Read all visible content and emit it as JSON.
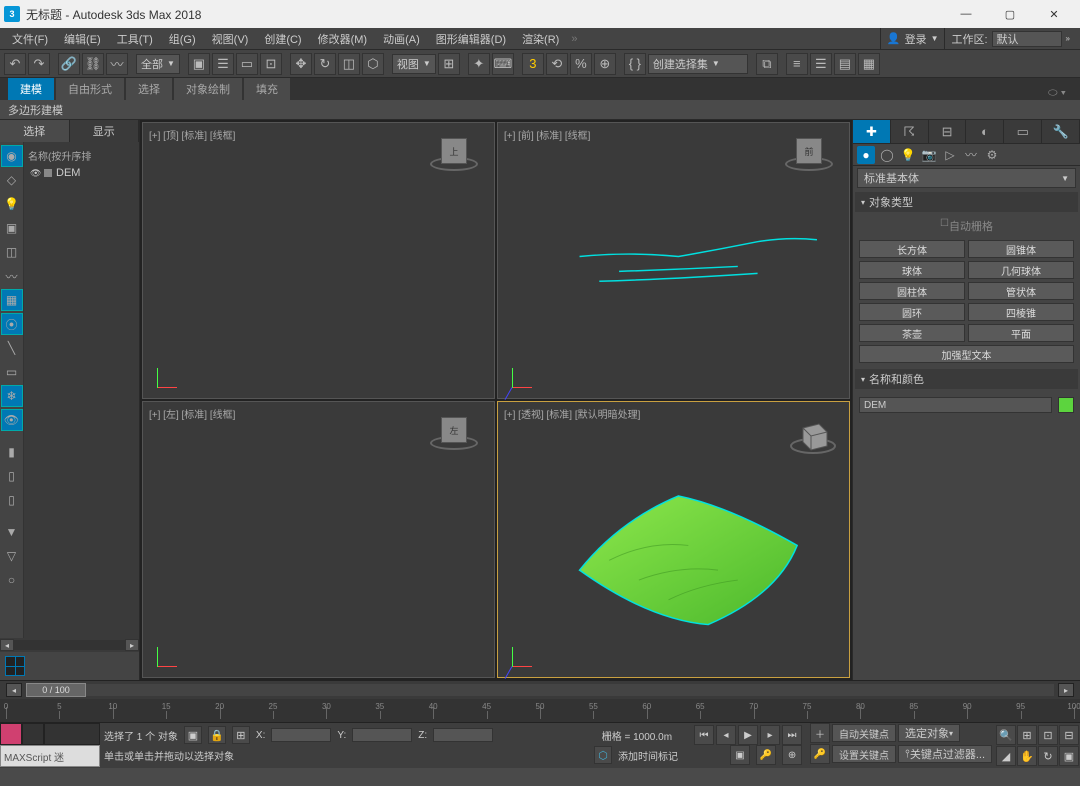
{
  "title": "无标题 - Autodesk 3ds Max 2018",
  "menu": {
    "items": [
      "文件(F)",
      "编辑(E)",
      "工具(T)",
      "组(G)",
      "视图(V)",
      "创建(C)",
      "修改器(M)",
      "动画(A)",
      "图形编辑器(D)",
      "渲染(R)"
    ],
    "login_label": "登录",
    "workarea_label": "工作区:",
    "workarea_value": "默认"
  },
  "toolbar": {
    "all_filter": "全部",
    "view_drop": "视图",
    "sel_set": "创建选择集"
  },
  "ribbon": {
    "tabs": [
      "建模",
      "自由形式",
      "选择",
      "对象绘制",
      "填充"
    ],
    "subtab": "多边形建模"
  },
  "left": {
    "tabs": [
      "选择",
      "显示"
    ],
    "tree_header": "名称(按升序排",
    "item_name": "DEM"
  },
  "viewports": {
    "tl": "[+] [顶] [标准] [线框]",
    "tr": "[+] [前] [标准] [线框]",
    "bl": "[+] [左] [标准] [线框]",
    "br": "[+] [透视] [标准] [默认明暗处理]",
    "cube_tl": "上",
    "cube_tr": "前",
    "cube_bl": "左"
  },
  "cmd": {
    "category": "标准基本体",
    "rollout1": "对象类型",
    "auto_grid": "自动栅格",
    "prims": [
      "长方体",
      "圆锥体",
      "球体",
      "几何球体",
      "圆柱体",
      "管状体",
      "圆环",
      "四棱锥",
      "茶壶",
      "平面",
      "加强型文本"
    ],
    "rollout2": "名称和颜色",
    "obj_name": "DEM"
  },
  "timeline": {
    "slider_text": "0 / 100",
    "ticks": [
      0,
      5,
      10,
      15,
      20,
      25,
      30,
      35,
      40,
      45,
      50,
      55,
      60,
      65,
      70,
      75,
      80,
      85,
      90,
      95,
      100
    ]
  },
  "status": {
    "sel_text": "选择了 1 个 对象",
    "hint": "单击或单击并拖动以选择对象",
    "x_label": "X:",
    "y_label": "Y:",
    "z_label": "Z:",
    "grid_label": "栅格 = 1000.0m",
    "time_tag": "添加时间标记",
    "auto_key": "自动关键点",
    "sel_obj": "选定对象",
    "set_key": "设置关键点",
    "key_filter": "关键点过滤器...",
    "maxscript": "MAXScript  迷"
  }
}
